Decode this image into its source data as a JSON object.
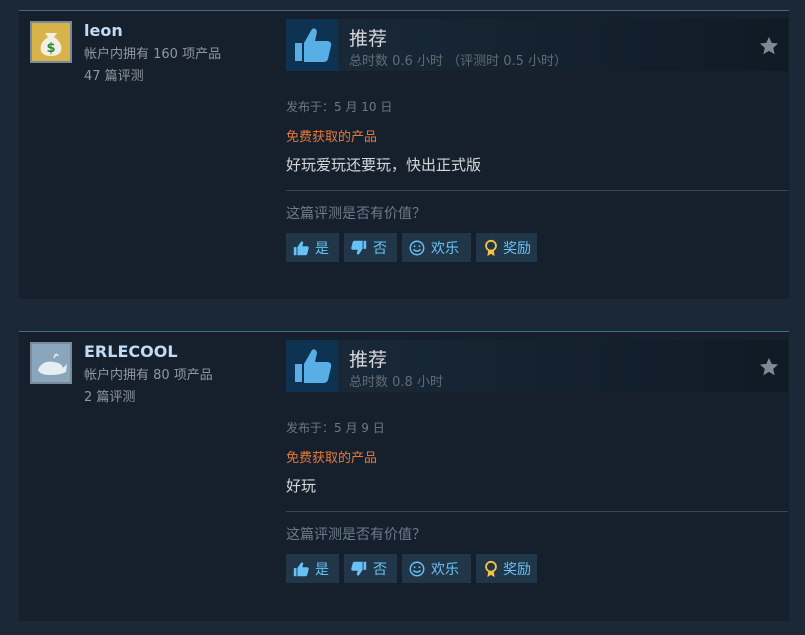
{
  "reviews": [
    {
      "author": {
        "name": "leon",
        "products": "帐户内拥有 160 项产品",
        "review_count": "47 篇评测",
        "avatar_icon": "money-bag-icon"
      },
      "verdict": "推荐",
      "hours": "总时数 0.6 小时 （评测时 0.5 小时）",
      "posted": "发布于：5 月 10 日",
      "free_tag": "免费获取的产品",
      "body": "好玩爱玩还要玩，快出正式版",
      "helpful_question": "这篇评测是否有价值？",
      "buttons": {
        "yes": "是",
        "no": "否",
        "funny": "欢乐",
        "award": "奖励"
      }
    },
    {
      "author": {
        "name": "ERLECOOL",
        "products": "帐户内拥有 80 项产品",
        "review_count": "2 篇评测",
        "avatar_icon": "whale-icon"
      },
      "verdict": "推荐",
      "hours": "总时数 0.8 小时",
      "posted": "发布于：5 月 9 日",
      "free_tag": "免费获取的产品",
      "body": "好玩",
      "helpful_question": "这篇评测是否有价值？",
      "buttons": {
        "yes": "是",
        "no": "否",
        "funny": "欢乐",
        "award": "奖励"
      }
    }
  ],
  "colors": {
    "background": "#1b2838",
    "card": "#16202d",
    "link": "#67c1f5",
    "free_tag": "#e87839",
    "author_name": "#c1dbf4"
  }
}
